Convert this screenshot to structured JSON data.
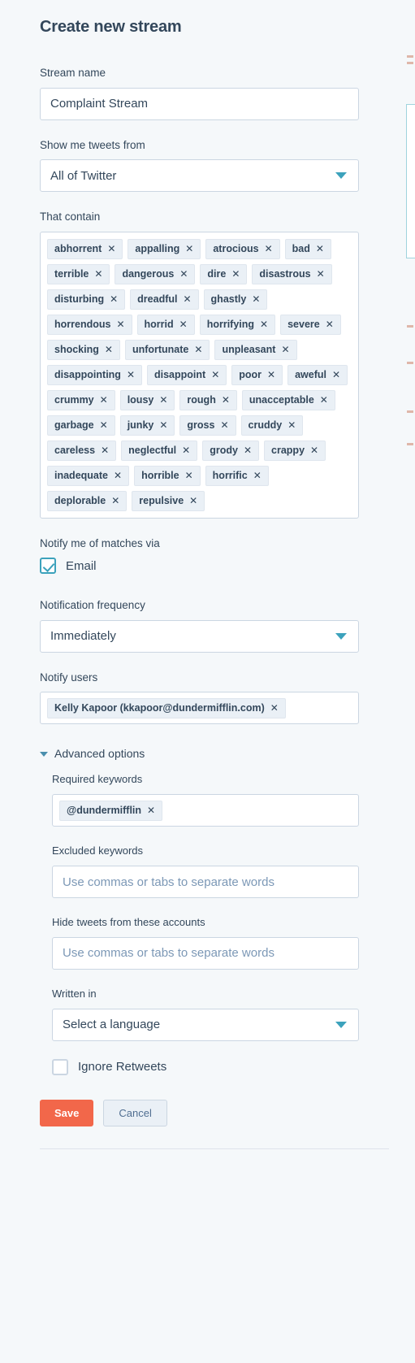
{
  "header": {
    "title": "Create new stream"
  },
  "stream_name": {
    "label": "Stream name",
    "value": "Complaint Stream"
  },
  "source": {
    "label": "Show me tweets from",
    "value": "All of Twitter"
  },
  "contains": {
    "label": "That contain",
    "tags": [
      "abhorrent",
      "appalling",
      "atrocious",
      "bad",
      "terrible",
      "dangerous",
      "dire",
      "disastrous",
      "disturbing",
      "dreadful",
      "ghastly",
      "horrendous",
      "horrid",
      "horrifying",
      "severe",
      "shocking",
      "unfortunate",
      "unpleasant",
      "disappointing",
      "disappoint",
      "poor",
      "aweful",
      "crummy",
      "lousy",
      "rough",
      "unacceptable",
      "garbage",
      "junky",
      "gross",
      "cruddy",
      "careless",
      "neglectful",
      "grody",
      "crappy",
      "inadequate",
      "horrible",
      "horrific",
      "deplorable",
      "repulsive"
    ]
  },
  "notify_via": {
    "label": "Notify me of matches via",
    "email_label": "Email",
    "email_checked": true
  },
  "frequency": {
    "label": "Notification frequency",
    "value": "Immediately"
  },
  "notify_users": {
    "label": "Notify users",
    "users": [
      "Kelly Kapoor (kkapoor@dundermifflin.com)"
    ]
  },
  "advanced": {
    "toggle_label": "Advanced options",
    "required_keywords": {
      "label": "Required keywords",
      "tags": [
        "@dundermifflin"
      ]
    },
    "excluded_keywords": {
      "label": "Excluded keywords",
      "placeholder": "Use commas or tabs to separate words",
      "value": ""
    },
    "hide_accounts": {
      "label": "Hide tweets from these accounts",
      "placeholder": "Use commas or tabs to separate words",
      "value": ""
    },
    "written_in": {
      "label": "Written in",
      "value": "Select a language"
    },
    "ignore_retweets": {
      "label": "Ignore Retweets",
      "checked": false
    }
  },
  "actions": {
    "save_label": "Save",
    "cancel_label": "Cancel"
  },
  "icons": {
    "remove": "✕",
    "caret_down": "caret-down-icon"
  },
  "colors": {
    "page_bg": "#f5f8fa",
    "text": "#33475b",
    "accent_teal": "#3ca2bc",
    "save_orange": "#f2674a",
    "chip_bg": "#eaf0f6",
    "border": "#cbd6e2"
  }
}
